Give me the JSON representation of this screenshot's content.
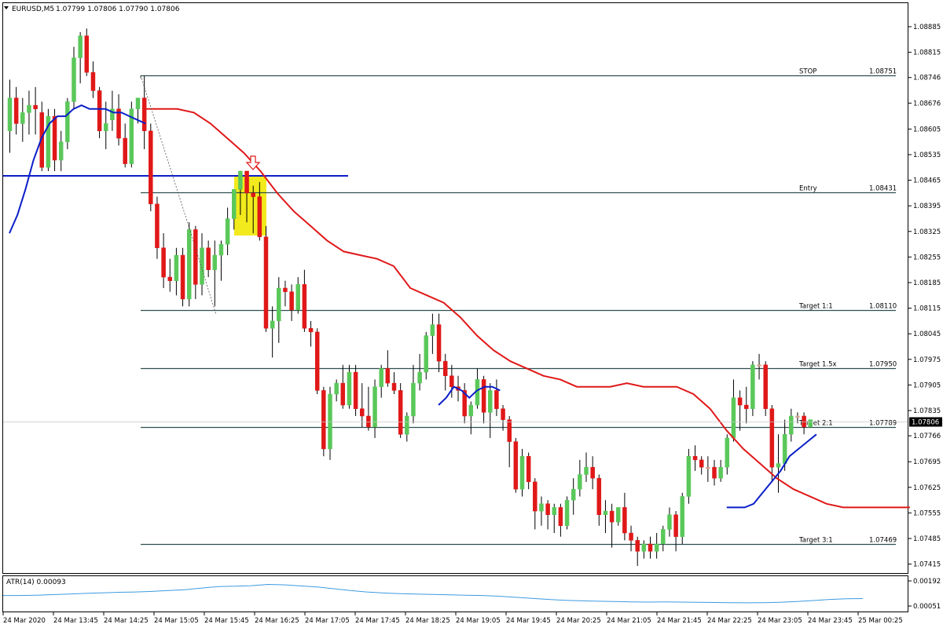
{
  "header": {
    "symbol": "EURUSD,M5",
    "ohlc": "1.07799 1.07806 1.07790 1.07806"
  },
  "colors": {
    "bull": "#5ac85a",
    "bear": "#e01818",
    "doji": "#d9a08a",
    "level_line": "#2f4f4f",
    "blue_line": "#0a1ec8",
    "ma_red": "#e01818",
    "ma_blue": "#0a1ec8",
    "highlight": "#f2ea1c",
    "atr_line": "#3c9be0",
    "current_price_box": "#000000"
  },
  "price_axis": {
    "ticks": [
      "1.08885",
      "1.08815",
      "1.08746",
      "1.08676",
      "1.08605",
      "1.08535",
      "1.08465",
      "1.08395",
      "1.08325",
      "1.08255",
      "1.08185",
      "1.08115",
      "1.08045",
      "1.07975",
      "1.07905",
      "1.07835",
      "1.07766",
      "1.07695",
      "1.07625",
      "1.07555",
      "1.07485",
      "1.07415"
    ],
    "current_price": "1.07806"
  },
  "time_axis": {
    "labels": [
      "24 Mar 2020",
      "24 Mar 13:45",
      "24 Mar 14:25",
      "24 Mar 15:05",
      "24 Mar 15:45",
      "24 Mar 16:25",
      "24 Mar 17:05",
      "24 Mar 17:45",
      "24 Mar 18:25",
      "24 Mar 19:05",
      "24 Mar 19:45",
      "24 Mar 20:25",
      "24 Mar 21:05",
      "24 Mar 21:45",
      "24 Mar 22:25",
      "24 Mar 23:05",
      "24 Mar 23:45",
      "25 Mar 00:25"
    ]
  },
  "levels": [
    {
      "name": "STOP",
      "value": "1.08751",
      "price": 1.08751
    },
    {
      "name": "Entry",
      "value": "1.08431",
      "price": 1.08431
    },
    {
      "name": "Target 1:1",
      "value": "1.08110",
      "price": 1.0811
    },
    {
      "name": "Target 1.5x",
      "value": "1.07950",
      "price": 1.0795
    },
    {
      "name": "Target 2:1",
      "value": "1.07789",
      "price": 1.07789
    },
    {
      "name": "Target 3:1",
      "value": "1.07469",
      "price": 1.07469
    }
  ],
  "atr": {
    "label": "ATR(14) 0.00093",
    "ticks": [
      "0.00192",
      "0.00051"
    ],
    "values": [
      0.0011,
      0.0011,
      0.00112,
      0.00115,
      0.00118,
      0.00122,
      0.00125,
      0.00128,
      0.0013,
      0.00133,
      0.00138,
      0.00142,
      0.00152,
      0.0016,
      0.00162,
      0.00165,
      0.00172,
      0.0017,
      0.00164,
      0.00158,
      0.00148,
      0.00138,
      0.0013,
      0.00124,
      0.0012,
      0.00118,
      0.00116,
      0.00114,
      0.00112,
      0.0011,
      0.00106,
      0.001,
      0.00094,
      0.00088,
      0.00083,
      0.0008,
      0.00078,
      0.00076,
      0.00074,
      0.00073,
      0.00074,
      0.00073,
      0.00072,
      0.00071,
      0.0007,
      0.00069,
      0.0007,
      0.00072,
      0.00076,
      0.00082,
      0.00088,
      0.00092,
      0.00093
    ]
  },
  "chart_data": {
    "type": "candlestick",
    "title": "EURUSD,M5",
    "ylim": [
      1.0738,
      1.0892
    ],
    "candles": [
      [
        1.086,
        1.0874,
        1.0854,
        1.0869
      ],
      [
        1.0869,
        1.0872,
        1.0859,
        1.0862
      ],
      [
        1.0862,
        1.0869,
        1.0857,
        1.0865
      ],
      [
        1.0865,
        1.0871,
        1.0859,
        1.0867
      ],
      [
        1.0867,
        1.0872,
        1.0859,
        1.0866
      ],
      [
        1.0865,
        1.0868,
        1.0849,
        1.085
      ],
      [
        1.085,
        1.0866,
        1.0849,
        1.0864
      ],
      [
        1.0864,
        1.0866,
        1.0849,
        1.0852
      ],
      [
        1.0852,
        1.086,
        1.0849,
        1.0857
      ],
      [
        1.0857,
        1.0869,
        1.0855,
        1.0868
      ],
      [
        1.0868,
        1.0883,
        1.0866,
        1.088
      ],
      [
        1.088,
        1.0887,
        1.0873,
        1.0886
      ],
      [
        1.0886,
        1.0888,
        1.0875,
        1.0876
      ],
      [
        1.0876,
        1.0879,
        1.0869,
        1.0871
      ],
      [
        1.0871,
        1.0872,
        1.0858,
        1.086
      ],
      [
        1.086,
        1.0868,
        1.0855,
        1.0862
      ],
      [
        1.0863,
        1.0871,
        1.086,
        1.0866
      ],
      [
        1.0866,
        1.087,
        1.0856,
        1.0858
      ],
      [
        1.0858,
        1.0862,
        1.085,
        1.0851
      ],
      [
        1.0851,
        1.0868,
        1.085,
        1.0866
      ],
      [
        1.0866,
        1.0869,
        1.0862,
        1.0869
      ],
      [
        1.0869,
        1.0875,
        1.0855,
        1.086
      ],
      [
        1.086,
        1.0862,
        1.0838,
        1.084
      ],
      [
        1.084,
        1.0842,
        1.0825,
        1.0828
      ],
      [
        1.0828,
        1.0832,
        1.0817,
        1.082
      ],
      [
        1.082,
        1.0825,
        1.0816,
        1.0819
      ],
      [
        1.0819,
        1.0828,
        1.0815,
        1.0826
      ],
      [
        1.0826,
        1.0828,
        1.0812,
        1.0814
      ],
      [
        1.0814,
        1.0835,
        1.0812,
        1.0833
      ],
      [
        1.0833,
        1.0834,
        1.0814,
        1.0818
      ],
      [
        1.0818,
        1.0832,
        1.0815,
        1.0828
      ],
      [
        1.0828,
        1.083,
        1.082,
        1.0822
      ],
      [
        1.0822,
        1.083,
        1.0812,
        1.0826
      ],
      [
        1.0826,
        1.083,
        1.0819,
        1.0829
      ],
      [
        1.0829,
        1.0839,
        1.0826,
        1.0836
      ],
      [
        1.0836,
        1.0844,
        1.0833,
        1.0844
      ],
      [
        1.0844,
        1.0849,
        1.0837,
        1.0849
      ],
      [
        1.0849,
        1.0849,
        1.0835,
        1.0843
      ],
      [
        1.0843,
        1.0845,
        1.0832,
        1.0842
      ],
      [
        1.0842,
        1.0846,
        1.083,
        1.0831
      ],
      [
        1.0831,
        1.0834,
        1.0805,
        1.0806
      ],
      [
        1.0806,
        1.0812,
        1.0798,
        1.0808
      ],
      [
        1.0808,
        1.082,
        1.0802,
        1.0817
      ],
      [
        1.0817,
        1.0819,
        1.0812,
        1.0816
      ],
      [
        1.0816,
        1.0818,
        1.0808,
        1.0811
      ],
      [
        1.0811,
        1.082,
        1.081,
        1.0818
      ],
      [
        1.0818,
        1.0822,
        1.0805,
        1.0806
      ],
      [
        1.0806,
        1.0808,
        1.0801,
        1.0805
      ],
      [
        1.0805,
        1.0806,
        1.0788,
        1.0789
      ],
      [
        1.0789,
        1.079,
        1.0771,
        1.0773
      ],
      [
        1.0773,
        1.079,
        1.077,
        1.0788
      ],
      [
        1.0788,
        1.0792,
        1.0786,
        1.0791
      ],
      [
        1.0791,
        1.0796,
        1.0784,
        1.0785
      ],
      [
        1.0785,
        1.0796,
        1.0784,
        1.0794
      ],
      [
        1.0794,
        1.0796,
        1.0782,
        1.0784
      ],
      [
        1.0784,
        1.0791,
        1.0779,
        1.0782
      ],
      [
        1.0782,
        1.079,
        1.0778,
        1.0779
      ],
      [
        1.0779,
        1.0792,
        1.0776,
        1.079
      ],
      [
        1.079,
        1.0796,
        1.0787,
        1.0795
      ],
      [
        1.0795,
        1.08,
        1.079,
        1.0791
      ],
      [
        1.0791,
        1.0794,
        1.0788,
        1.0789
      ],
      [
        1.0789,
        1.0791,
        1.0776,
        1.0777
      ],
      [
        1.0777,
        1.0783,
        1.0775,
        1.0782
      ],
      [
        1.0782,
        1.0796,
        1.078,
        1.0791
      ],
      [
        1.0791,
        1.0799,
        1.0789,
        1.0794
      ],
      [
        1.0794,
        1.0805,
        1.0792,
        1.0804
      ],
      [
        1.0804,
        1.081,
        1.0799,
        1.0807
      ],
      [
        1.0807,
        1.081,
        1.0794,
        1.0797
      ],
      [
        1.0797,
        1.0799,
        1.0789,
        1.0793
      ],
      [
        1.0793,
        1.0796,
        1.0787,
        1.079
      ],
      [
        1.079,
        1.0793,
        1.0786,
        1.0789
      ],
      [
        1.0789,
        1.0791,
        1.078,
        1.0782
      ],
      [
        1.0782,
        1.0786,
        1.0777,
        1.0785
      ],
      [
        1.0785,
        1.0795,
        1.0784,
        1.0792
      ],
      [
        1.0792,
        1.0793,
        1.078,
        1.0783
      ],
      [
        1.0783,
        1.0791,
        1.0776,
        1.0789
      ],
      [
        1.0789,
        1.0792,
        1.0782,
        1.0784
      ],
      [
        1.0784,
        1.0785,
        1.0778,
        1.0781
      ],
      [
        1.0781,
        1.0782,
        1.0768,
        1.0775
      ],
      [
        1.0775,
        1.0776,
        1.0761,
        1.0762
      ],
      [
        1.0762,
        1.0773,
        1.076,
        1.0771
      ],
      [
        1.0771,
        1.0772,
        1.0762,
        1.0764
      ],
      [
        1.0764,
        1.0765,
        1.0751,
        1.0756
      ],
      [
        1.0756,
        1.076,
        1.0752,
        1.0758
      ],
      [
        1.0758,
        1.0759,
        1.0751,
        1.0755
      ],
      [
        1.0755,
        1.0758,
        1.075,
        1.0757
      ],
      [
        1.0757,
        1.0758,
        1.0749,
        1.0752
      ],
      [
        1.0752,
        1.076,
        1.0751,
        1.0759
      ],
      [
        1.0759,
        1.0765,
        1.0755,
        1.0762
      ],
      [
        1.0762,
        1.077,
        1.076,
        1.0766
      ],
      [
        1.0766,
        1.0772,
        1.0764,
        1.0768
      ],
      [
        1.0768,
        1.0771,
        1.0762,
        1.0765
      ],
      [
        1.0765,
        1.0766,
        1.0752,
        1.0755
      ],
      [
        1.0755,
        1.0759,
        1.075,
        1.0756
      ],
      [
        1.0756,
        1.0758,
        1.0746,
        1.0753
      ],
      [
        1.0753,
        1.0757,
        1.0752,
        1.0757
      ],
      [
        1.0757,
        1.0761,
        1.0748,
        1.075
      ],
      [
        1.075,
        1.0752,
        1.0745,
        1.0748
      ],
      [
        1.0748,
        1.0749,
        1.0741,
        1.0745
      ],
      [
        1.0745,
        1.0748,
        1.0743,
        1.0747
      ],
      [
        1.0747,
        1.0749,
        1.0743,
        1.0745
      ],
      [
        1.0745,
        1.075,
        1.0743,
        1.0747
      ],
      [
        1.0747,
        1.0752,
        1.0745,
        1.0751
      ],
      [
        1.0751,
        1.0757,
        1.0749,
        1.0755
      ],
      [
        1.0755,
        1.0756,
        1.0745,
        1.0749
      ],
      [
        1.0749,
        1.0761,
        1.0747,
        1.076
      ],
      [
        1.076,
        1.0773,
        1.0758,
        1.0771
      ],
      [
        1.0771,
        1.0774,
        1.0767,
        1.077
      ],
      [
        1.077,
        1.0771,
        1.0766,
        1.0768
      ],
      [
        1.0768,
        1.0771,
        1.0764,
        1.0768
      ],
      [
        1.0768,
        1.077,
        1.0763,
        1.0765
      ],
      [
        1.0765,
        1.077,
        1.0764,
        1.0768
      ],
      [
        1.0768,
        1.0777,
        1.0766,
        1.0776
      ],
      [
        1.0776,
        1.0792,
        1.0775,
        1.0787
      ],
      [
        1.0787,
        1.0789,
        1.0778,
        1.0785
      ],
      [
        1.0785,
        1.079,
        1.078,
        1.0784
      ],
      [
        1.0784,
        1.0797,
        1.0782,
        1.0796
      ],
      [
        1.0796,
        1.0799,
        1.0792,
        1.0796
      ],
      [
        1.0796,
        1.0797,
        1.0782,
        1.0784
      ],
      [
        1.0784,
        1.0785,
        1.0764,
        1.0768
      ],
      [
        1.0768,
        1.0777,
        1.0761,
        1.0769
      ],
      [
        1.0769,
        1.0781,
        1.0767,
        1.0777
      ],
      [
        1.0777,
        1.0784,
        1.0775,
        1.0782
      ],
      [
        1.0782,
        1.0783,
        1.078,
        1.0782
      ],
      [
        1.0782,
        1.0783,
        1.0777,
        1.0779
      ],
      [
        1.0779,
        1.0781,
        1.0779,
        1.0781
      ]
    ],
    "ma_red": [
      1.0866,
      1.0866,
      1.0866,
      1.0865,
      1.0862,
      1.0858,
      1.0854,
      1.0849,
      1.0843,
      1.0838,
      1.0834,
      1.083,
      1.0827,
      1.0826,
      1.0825,
      1.0823,
      1.0817,
      1.0815,
      1.0813,
      1.0809,
      1.0804,
      1.08,
      1.0797,
      1.0795,
      1.0793,
      1.0792,
      1.079,
      1.079,
      1.079,
      1.0791,
      1.079,
      1.079,
      1.079,
      1.0788,
      1.0784,
      1.0778,
      1.0773,
      1.0769,
      1.0765,
      1.0762,
      1.076,
      1.0758,
      1.0757,
      1.0757,
      1.0757,
      1.0757,
      1.0757
    ],
    "ma_blue": [
      1.0832,
      1.0837,
      1.0844,
      1.0852,
      1.0858,
      1.0862,
      1.0864,
      1.0864,
      1.0866,
      1.0867,
      1.0866,
      1.0866,
      1.0866,
      1.0865,
      1.0865,
      1.0864,
      1.0863,
      1.0862
    ],
    "ma_blue_late": [
      1.0785,
      1.0787,
      1.079,
      1.0789,
      1.0787,
      1.0789,
      1.079,
      1.079,
      1.0789
    ],
    "ma_blue_end": [
      1.0757,
      1.0757,
      1.0757,
      1.0758,
      1.0761,
      1.0764,
      1.0767,
      1.0771,
      1.0773,
      1.0775,
      1.0777
    ]
  }
}
